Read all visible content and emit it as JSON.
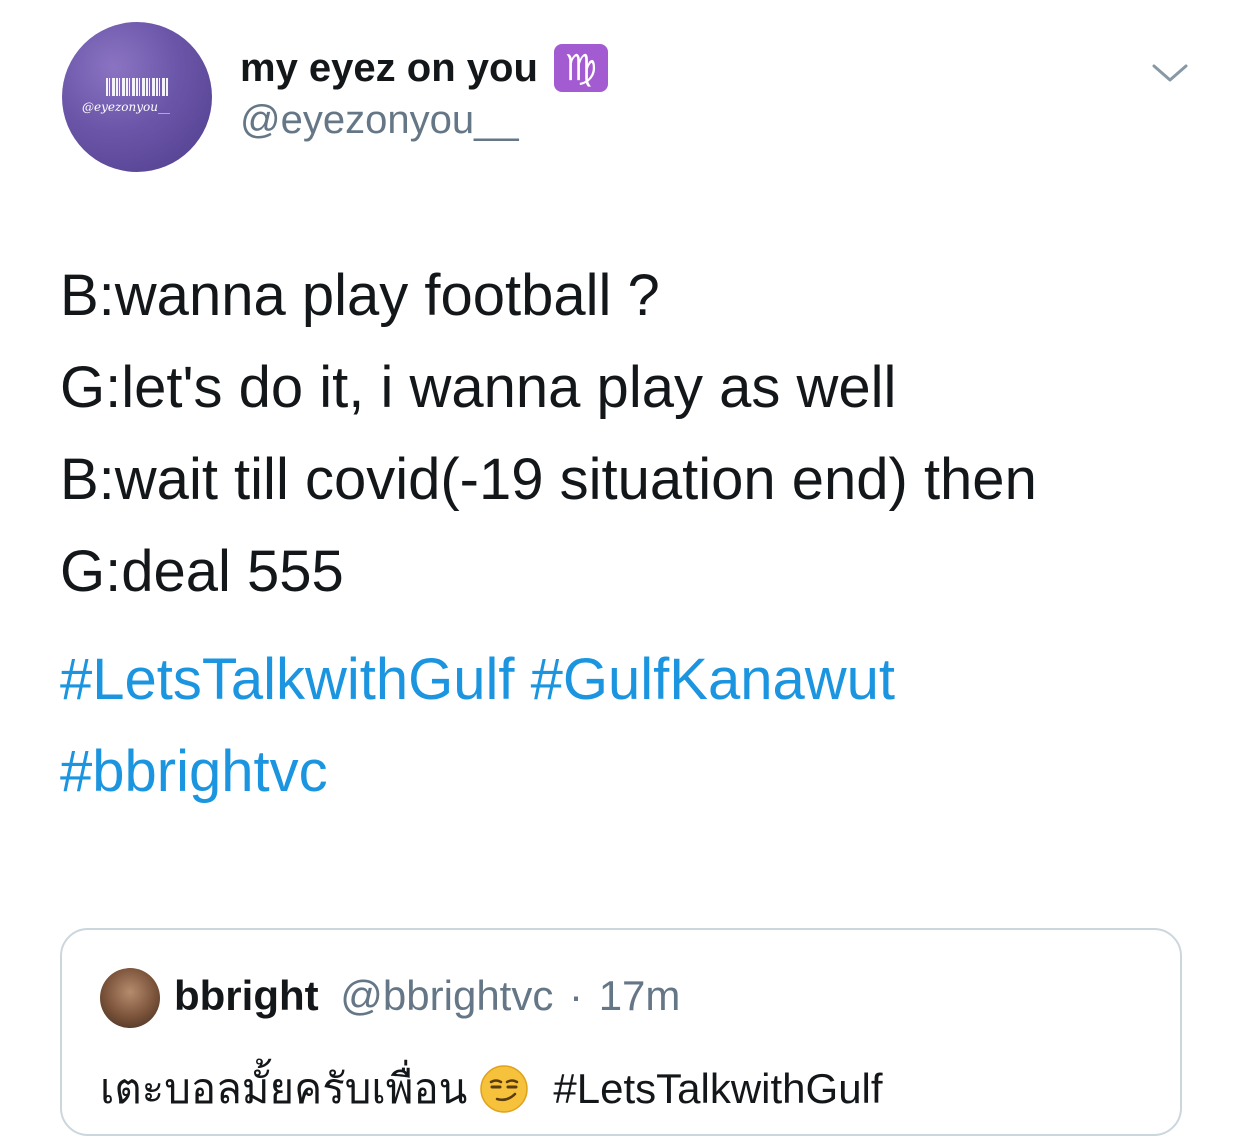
{
  "tweet": {
    "author": {
      "display_name": "my eyez on you",
      "zodiac_glyph": "♍",
      "handle": "@eyezonyou__",
      "avatar_text": "@eyezonyou__",
      "avatar_color": "#6b55a8"
    },
    "lines": [
      "B:wanna play football ?",
      "G:let's do it, i wanna play as well",
      "B:wait till covid(-19 situation end) then",
      "G:deal 555"
    ],
    "hashtags": [
      [
        "#LetsTalkwithGulf",
        "#GulfKanawut"
      ],
      [
        "#bbrightvc"
      ]
    ],
    "hashtag_color": "#1b95e0"
  },
  "quoted": {
    "name": "bbright",
    "handle": "@bbrightvc",
    "separator": "·",
    "time": "17m",
    "text": "เตะบอลมั้ยครับเพื่อน",
    "emoji": "smirking-face-icon",
    "hashtag": "#LetsTalkwithGulf"
  }
}
